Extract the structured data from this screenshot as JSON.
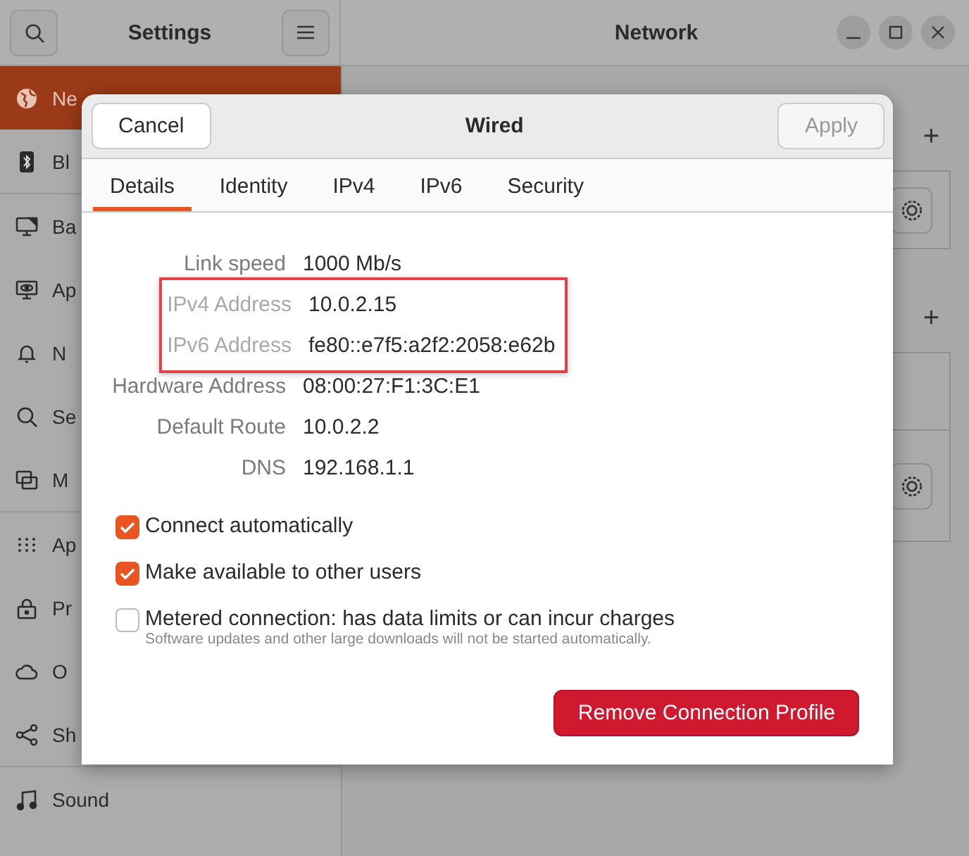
{
  "settings_header": {
    "title": "Settings"
  },
  "window": {
    "title": "Network"
  },
  "sidebar": {
    "sections": [
      {
        "items": [
          {
            "label": "Ne",
            "selected": true
          },
          {
            "label": "Bl",
            "selected": false
          }
        ]
      },
      {
        "items": [
          {
            "label": "Ba",
            "selected": false
          },
          {
            "label": "Ap",
            "selected": false
          },
          {
            "label": "N",
            "selected": false
          },
          {
            "label": "Se",
            "selected": false
          },
          {
            "label": "M",
            "selected": false
          }
        ]
      },
      {
        "items": [
          {
            "label": "Ap",
            "selected": false
          },
          {
            "label": "Pr",
            "selected": false
          },
          {
            "label": "O",
            "selected": false
          },
          {
            "label": "Sh",
            "selected": false
          }
        ]
      },
      {
        "items": [
          {
            "label": "Sound",
            "selected": false
          }
        ]
      }
    ]
  },
  "panel": {
    "sections": [
      {
        "add_label": "+",
        "cards": [
          {
            "kind": "gear"
          }
        ]
      },
      {
        "add_label": "+",
        "cards": [
          {
            "kind": "plain"
          },
          {
            "kind": "gear"
          }
        ]
      }
    ]
  },
  "dialog": {
    "title": "Wired",
    "cancel": "Cancel",
    "apply": {
      "label": "Apply",
      "disabled": true
    },
    "tabs": [
      {
        "label": "Details",
        "selected": true
      },
      {
        "label": "Identity",
        "selected": false
      },
      {
        "label": "IPv4",
        "selected": false
      },
      {
        "label": "IPv6",
        "selected": false
      },
      {
        "label": "Security",
        "selected": false
      }
    ],
    "details": [
      {
        "label": "Link speed",
        "value": "1000 Mb/s",
        "highlighted": false
      },
      {
        "label": "IPv4 Address",
        "value": "10.0.2.15",
        "highlighted": true
      },
      {
        "label": "IPv6 Address",
        "value": "fe80::e7f5:a2f2:2058:e62b",
        "highlighted": true
      },
      {
        "label": "Hardware Address",
        "value": "08:00:27:F1:3C:E1",
        "highlighted": false
      },
      {
        "label": "Default Route",
        "value": "10.0.2.2",
        "highlighted": false
      },
      {
        "label": "DNS",
        "value": "192.168.1.1",
        "highlighted": false
      }
    ],
    "options": [
      {
        "label": "Connect automatically",
        "checked": true
      },
      {
        "label": "Make available to other users",
        "checked": true
      },
      {
        "label": "Metered connection: has data limits or can incur charges",
        "hint": "Software updates and other large downloads will not be started automatically.",
        "checked": false
      }
    ],
    "remove_button": "Remove Connection Profile"
  }
}
